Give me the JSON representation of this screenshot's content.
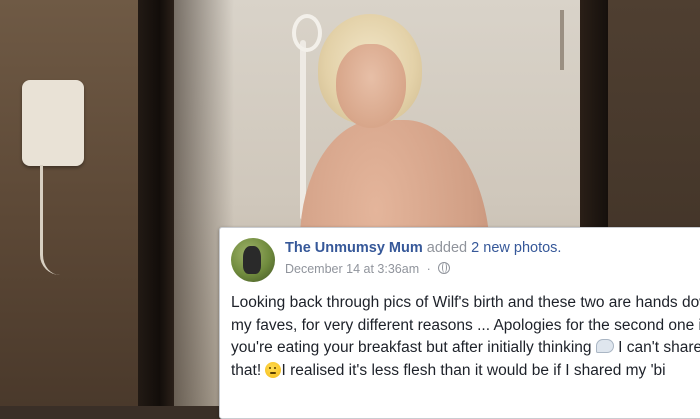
{
  "post": {
    "author": "The Unmumsy Mum",
    "action": "added",
    "photos_link": "2 new photos.",
    "timestamp": "December 14 at 3:36am",
    "separator": "·",
    "privacy_icon": "globe-icon",
    "body_lines": [
      "Looking back through pics of Wilf's birth and these two are hands down",
      "my faves, for very different reasons ... Apologies for the second one if",
      "you're eating your breakfast but after initially thinking",
      "I can't share",
      "that!",
      "I realised it's less flesh than it would be if I shared my 'bi"
    ],
    "inline_icons": [
      "speech-bubble-emoji",
      "thinking-face-emoji"
    ]
  },
  "colors": {
    "link": "#365899",
    "meta": "#90949c",
    "text": "#1d2129",
    "card_bg": "#ffffff"
  }
}
